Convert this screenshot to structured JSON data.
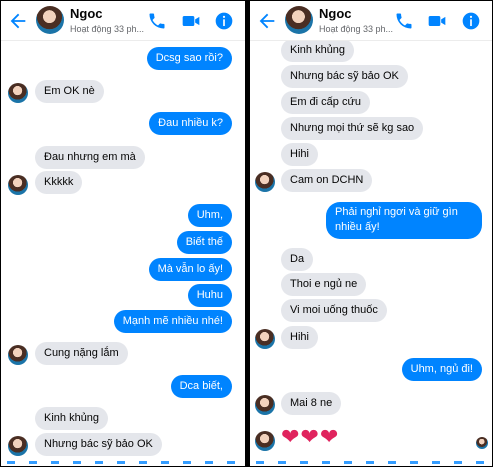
{
  "contact": {
    "name": "Ngoc",
    "status": "Hoạt động 33 ph..."
  },
  "colors": {
    "accent": "#0084ff",
    "incoming": "#e4e6eb",
    "heart": "#e0245e"
  },
  "icons": [
    "back-arrow-icon",
    "phone-icon",
    "video-camera-icon",
    "info-icon",
    "heart-icon"
  ],
  "left_panel": {
    "messages": [
      {
        "text": "Dcsg sao rồi?",
        "direction": "out"
      },
      {
        "text": "Em OK nè",
        "direction": "in"
      },
      {
        "text": "Đau nhiều k?",
        "direction": "out"
      },
      {
        "text": "Đau nhưng em mà",
        "direction": "in"
      },
      {
        "text": "Kkkkk",
        "direction": "in"
      },
      {
        "text": "Uhm,",
        "direction": "out"
      },
      {
        "text": "Biết thế",
        "direction": "out"
      },
      {
        "text": "Mà vẫn lo ấy!",
        "direction": "out"
      },
      {
        "text": "Huhu",
        "direction": "out"
      },
      {
        "text": "Mạnh mẽ nhiều nhé!",
        "direction": "out"
      },
      {
        "text": "Cung nặng lắm",
        "direction": "in"
      },
      {
        "text": "Dca biết,",
        "direction": "out"
      },
      {
        "text": "Kinh khủng",
        "direction": "in"
      },
      {
        "text": "Nhưng bác sỹ bảo OK",
        "direction": "in"
      }
    ]
  },
  "right_panel": {
    "messages": [
      {
        "text": "Kinh khủng",
        "direction": "in"
      },
      {
        "text": "Nhưng bác sỹ bảo OK",
        "direction": "in"
      },
      {
        "text": "Em đi cấp cứu",
        "direction": "in"
      },
      {
        "text": "Nhưng mọi thứ sẽ kg sao",
        "direction": "in"
      },
      {
        "text": "Hihi",
        "direction": "in"
      },
      {
        "text": "Cam on DCHN",
        "direction": "in"
      },
      {
        "text": "Phải nghỉ ngơi và giữ gìn nhiều ấy!",
        "direction": "out"
      },
      {
        "text": "Da",
        "direction": "in"
      },
      {
        "text": "Thoi e ngủ ne",
        "direction": "in"
      },
      {
        "text": "Vi moi uống thuốc",
        "direction": "in"
      },
      {
        "text": "Hihi",
        "direction": "in"
      },
      {
        "text": "Uhm, ngủ đi!",
        "direction": "out"
      },
      {
        "text": "Mai  8 ne",
        "direction": "in"
      },
      {
        "text": "❤❤❤",
        "direction": "in"
      }
    ]
  }
}
